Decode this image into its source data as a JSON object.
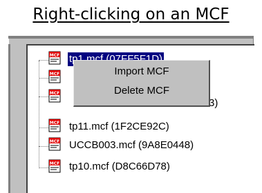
{
  "caption": "Right-clicking on an MCF",
  "icon_name": "mcf-file-icon",
  "tree": {
    "nodes": [
      {
        "label": "tp1 mcf (07FF5F1D)",
        "selected": true
      },
      {
        "label": "",
        "selected": false
      },
      {
        "label": "3)",
        "selected": false
      },
      {
        "label": "tp11.mcf (1F2CE92C)",
        "selected": false
      },
      {
        "label": "UCCB003.mcf (9A8E0448)",
        "selected": false
      },
      {
        "label": "tp10.mcf (D8C66D78)",
        "selected": false
      }
    ]
  },
  "context_menu": {
    "items": [
      {
        "label": "Import MCF"
      },
      {
        "label": "Delete MCF"
      }
    ]
  },
  "colors": {
    "selection": "#000080",
    "menu_bg": "#c0c0c0",
    "icon_red": "#e00000"
  }
}
